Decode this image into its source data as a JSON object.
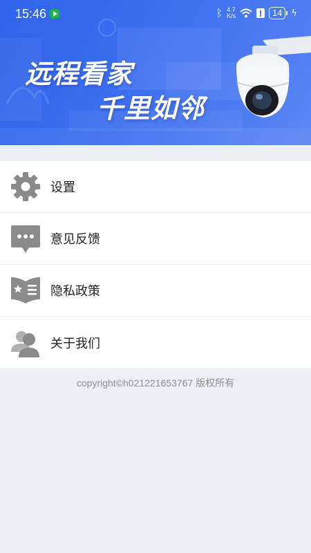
{
  "status_bar": {
    "time": "15:46",
    "network_speed_value": "4.7",
    "network_speed_unit": "K/s",
    "battery_level": "14"
  },
  "banner": {
    "slogan_line1": "远程看家",
    "slogan_line2": "千里如邻",
    "icons": [
      "camera-illustration"
    ]
  },
  "menu": {
    "items": [
      {
        "label": "设置",
        "icon": "gear-icon"
      },
      {
        "label": "意见反馈",
        "icon": "chat-bubble-icon"
      },
      {
        "label": "隐私政策",
        "icon": "book-star-icon"
      },
      {
        "label": "关于我们",
        "icon": "users-icon"
      }
    ]
  },
  "footer": {
    "copyright": "copyright©h021221653767 版权所有"
  },
  "colors": {
    "banner_blue": "#3567ee",
    "icon_gray": "#8a8a8a",
    "page_background": "#eceff6"
  }
}
